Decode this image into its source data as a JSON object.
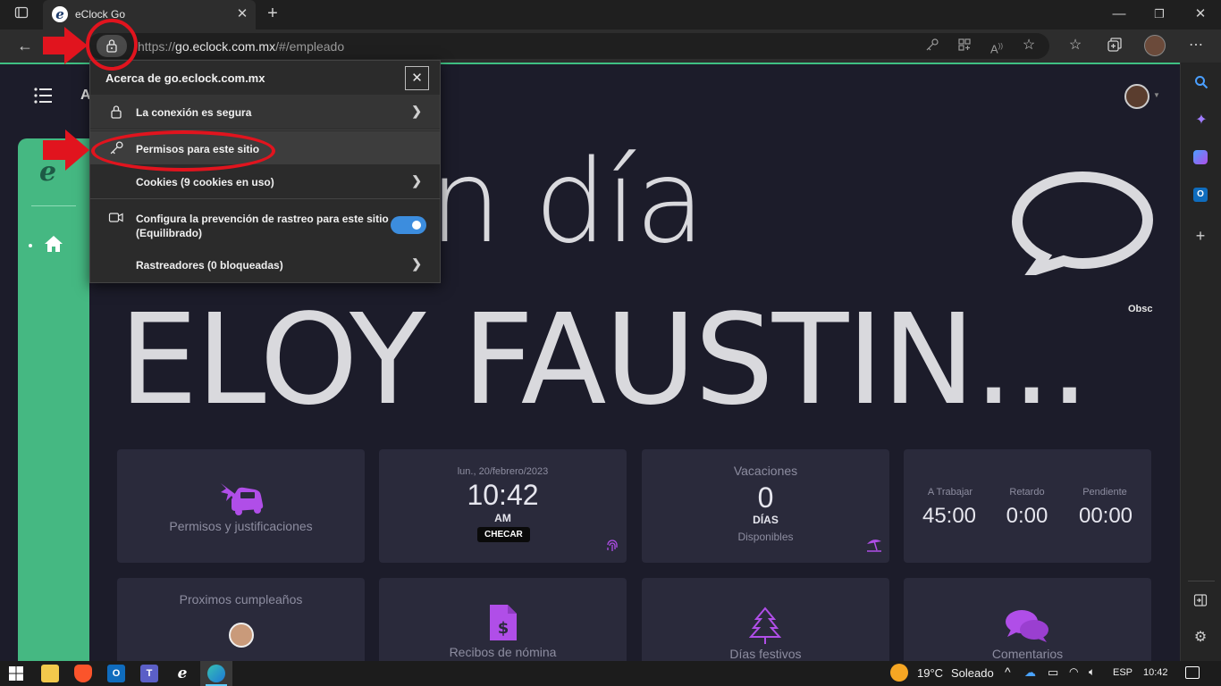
{
  "browser": {
    "tab_title": "eClock Go",
    "url_prefix": "https://",
    "url_domain": "go.eclock.com.mx",
    "url_path": "/#/empleado"
  },
  "popup": {
    "title": "Acerca de go.eclock.com.mx",
    "secure_label": "La conexión es segura",
    "permissions_label": "Permisos para este sitio",
    "cookies_label": "Cookies (9 cookies en uso)",
    "tracking_label_line1": "Configura la prevención de rastreo para este sitio",
    "tracking_label_line2": "(Equilibrado)",
    "trackers_label": "Rastreadores (0 bloqueadas)",
    "tracking_enabled": true
  },
  "header": {
    "letter": "A"
  },
  "page": {
    "greeting_line1": "n día",
    "greeting_line2": "ELOY FAUSTIN...",
    "obsc_label": "Obsc"
  },
  "cards": {
    "permisos_label": "Permisos y justificaciones",
    "date": "lun., 20/febrero/2023",
    "time": "10:42",
    "ampm": "AM",
    "checar_label": "CHECAR",
    "vacaciones_label": "Vacaciones",
    "vacaciones_count": "0",
    "vacaciones_unit": "DÍAS",
    "vacaciones_sub": "Disponibles",
    "trabajar_label": "A Trabajar",
    "trabajar_value": "45:00",
    "retardo_label": "Retardo",
    "retardo_value": "0:00",
    "pendiente_label": "Pendiente",
    "pendiente_value": "00:00",
    "cumple_label": "Proximos cumpleaños",
    "recibos_label": "Recibos de nómina",
    "festivos_label": "Días festivos",
    "comentarios_label": "Comentarios"
  },
  "taskbar": {
    "weather_temp": "19°C",
    "weather_desc": "Soleado",
    "lang": "ESP",
    "clock": "10:42"
  },
  "colors": {
    "accent_green": "#45b882",
    "purple": "#b04ee8",
    "annotation_red": "#e1141e"
  }
}
